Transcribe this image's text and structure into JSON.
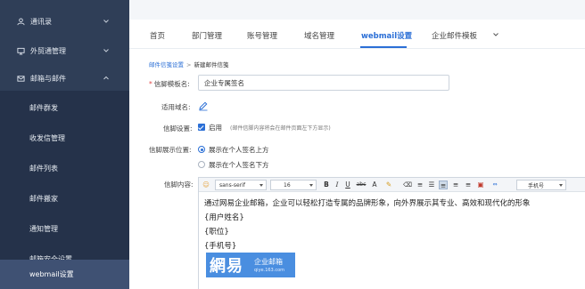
{
  "sidebar": {
    "groups": [
      {
        "icon": "person-icon",
        "label": "通讯录"
      },
      {
        "icon": "monitor-icon",
        "label": "外贸通管理"
      },
      {
        "icon": "mail-icon",
        "label": "邮箱与邮件"
      }
    ],
    "items": [
      {
        "label": "邮件群发"
      },
      {
        "label": "收发信管理"
      },
      {
        "label": "邮件列表"
      },
      {
        "label": "邮件搬家"
      },
      {
        "label": "通知管理"
      },
      {
        "label": "邮箱安全设置"
      },
      {
        "label": "webmail设置",
        "active": true
      }
    ]
  },
  "tabs": [
    {
      "label": "首页"
    },
    {
      "label": "部门管理"
    },
    {
      "label": "账号管理"
    },
    {
      "label": "域名管理"
    },
    {
      "label": "webmail设置",
      "active": true
    },
    {
      "label": "企业邮件模板"
    }
  ],
  "breadcrumb": {
    "parent": "邮件信笺设置",
    "separator": ">",
    "current": "新建邮件信笺"
  },
  "form": {
    "name_label": "信脚模板名:",
    "name_required": "*",
    "name_value": "企业专属签名",
    "domain_label": "适用域名:",
    "setting_label": "信脚设置:",
    "enable_text": "启用",
    "enable_hint": "(邮件信脚内容将会在邮件页面左下方显示)",
    "position_label": "信脚展示位置:",
    "position_options": [
      "展示在个人签名上方",
      "展示在个人签名下方"
    ],
    "position_selected": 0,
    "content_label": "信脚内容:"
  },
  "editor": {
    "font_family": "sans-serif",
    "font_size": "16",
    "placeholder_select": "手机号",
    "toolbar_buttons": [
      {
        "icon": "emoji-icon",
        "label": "☺"
      },
      {
        "icon": "bold-icon",
        "label": "B"
      },
      {
        "icon": "italic-icon",
        "label": "I"
      },
      {
        "icon": "underline-icon",
        "label": "U"
      },
      {
        "icon": "strikethrough-icon",
        "label": "abc"
      },
      {
        "icon": "font-color-icon",
        "label": "A"
      },
      {
        "icon": "highlight-icon",
        "label": "✎"
      },
      {
        "icon": "clear-format-icon",
        "label": "⌫"
      },
      {
        "icon": "ordered-list-icon",
        "label": "≡"
      },
      {
        "icon": "unordered-list-icon",
        "label": "☰"
      },
      {
        "icon": "align-left-icon",
        "label": "≡"
      },
      {
        "icon": "align-center-icon",
        "label": "≡"
      },
      {
        "icon": "align-right-icon",
        "label": "≡"
      },
      {
        "icon": "image-icon",
        "label": "▣"
      },
      {
        "icon": "link-icon",
        "label": "⇔"
      }
    ],
    "lines": [
      "通过网易企业邮箱，企业可以轻松打造专属的品牌形象，向外界展示其专业、高效和现代化的形象",
      "{用户姓名}",
      "{职位}",
      "{手机号}"
    ],
    "logo": {
      "big": "網易",
      "small": "企业邮箱",
      "url": "qiye.163.com"
    }
  },
  "colors": {
    "sidebar_bg": "#2f3e57",
    "accent": "#2b6fd6",
    "required": "#e34a4a"
  }
}
